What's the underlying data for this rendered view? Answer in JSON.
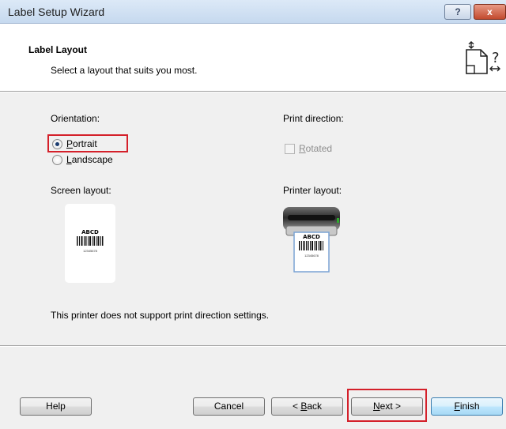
{
  "window": {
    "title": "Label Setup Wizard",
    "help_glyph": "?",
    "close_glyph": "x"
  },
  "header": {
    "title": "Label Layout",
    "subtitle": "Select a layout that suits you most."
  },
  "orientation": {
    "label": "Orientation:",
    "options": [
      {
        "accel": "P",
        "rest": "ortrait",
        "checked": true
      },
      {
        "accel": "L",
        "rest": "andscape",
        "checked": false
      }
    ]
  },
  "print_direction": {
    "label": "Print direction:",
    "rotated_accel": "R",
    "rotated_rest": "otated",
    "rotated_checked": false,
    "enabled": false
  },
  "screen_layout": {
    "label": "Screen layout:",
    "sample_text": "ABCD",
    "sample_number": "12345678"
  },
  "printer_layout": {
    "label": "Printer layout:",
    "sample_text": "ABCD",
    "sample_number": "12345678"
  },
  "note": "This printer does not support print direction settings.",
  "buttons": {
    "help": "Help",
    "cancel": "Cancel",
    "back_prefix": "< ",
    "back_accel": "B",
    "back_rest": "ack",
    "next_accel": "N",
    "next_rest": "ext >",
    "finish_accel": "F",
    "finish_rest": "inish"
  },
  "colors": {
    "highlight": "#d4202a",
    "dialog_bg": "#f0f0f0"
  }
}
